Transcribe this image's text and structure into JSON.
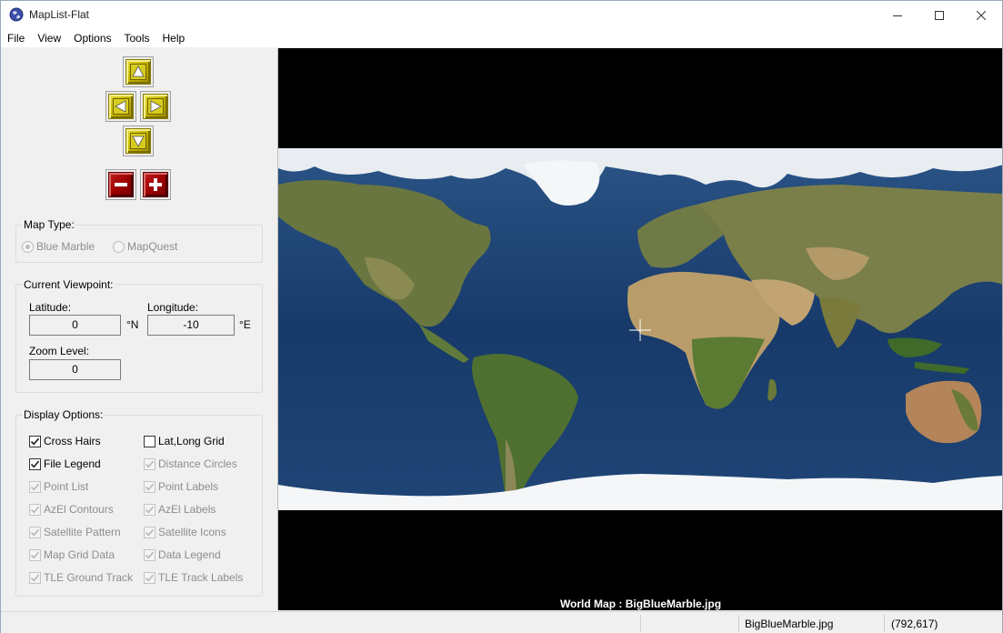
{
  "window": {
    "title": "MapList-Flat"
  },
  "menu": [
    "File",
    "View",
    "Options",
    "Tools",
    "Help"
  ],
  "map_type": {
    "title": "Map Type:",
    "options": [
      {
        "label": "Blue Marble",
        "selected": true
      },
      {
        "label": "MapQuest",
        "selected": false
      }
    ]
  },
  "viewpoint": {
    "title": "Current Viewpoint:",
    "latitude_label": "Latitude:",
    "latitude_value": "0",
    "latitude_unit": "°N",
    "longitude_label": "Longitude:",
    "longitude_value": "-10",
    "longitude_unit": "°E",
    "zoom_label": "Zoom Level:",
    "zoom_value": "0"
  },
  "display_options": {
    "title": "Display Options:",
    "left": [
      {
        "label": "Cross Hairs",
        "checked": true,
        "enabled": true
      },
      {
        "label": "File Legend",
        "checked": true,
        "enabled": true
      },
      {
        "label": "Point List",
        "checked": true,
        "enabled": false
      },
      {
        "label": "AzEl Contours",
        "checked": true,
        "enabled": false
      },
      {
        "label": "Satellite Pattern",
        "checked": true,
        "enabled": false
      },
      {
        "label": "Map Grid Data",
        "checked": true,
        "enabled": false
      },
      {
        "label": "TLE Ground Track",
        "checked": true,
        "enabled": false
      }
    ],
    "right": [
      {
        "label": "Lat,Long Grid",
        "checked": false,
        "enabled": true
      },
      {
        "label": "Distance Circles",
        "checked": true,
        "enabled": false
      },
      {
        "label": "Point Labels",
        "checked": true,
        "enabled": false
      },
      {
        "label": "AzEl Labels",
        "checked": true,
        "enabled": false
      },
      {
        "label": "Satellite Icons",
        "checked": true,
        "enabled": false
      },
      {
        "label": "Data Legend",
        "checked": true,
        "enabled": false
      },
      {
        "label": "TLE Track Labels",
        "checked": true,
        "enabled": false
      }
    ]
  },
  "map": {
    "legend": "World Map : BigBlueMarble.jpg"
  },
  "status": {
    "file": "BigBlueMarble.jpg",
    "coords": "(792,617)"
  },
  "colors": {
    "ocean": "#1d3f6e",
    "land": "#6b7a3a",
    "desert": "#c4a878",
    "ice": "#f4f6f8",
    "nav_yellow": "#c9b800",
    "zoom_red": "#a00000"
  }
}
